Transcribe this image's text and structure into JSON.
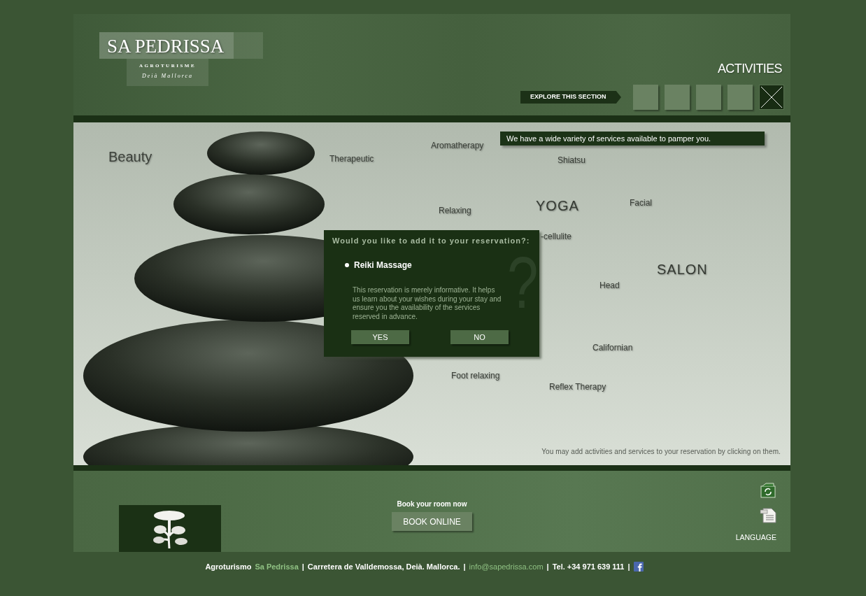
{
  "header": {
    "logo": {
      "name": "SA PEDRISSA",
      "subtitle": "AGROTURISME",
      "location": "Deià Mallorca"
    },
    "title": "ACTIVITIES",
    "explore": "EXPLORE THIS SECTION",
    "tiles": [
      {
        "kind": "blank"
      },
      {
        "kind": "blank"
      },
      {
        "kind": "blank"
      },
      {
        "kind": "blank"
      },
      {
        "kind": "close"
      }
    ]
  },
  "content": {
    "heading": "Beauty",
    "banner": "We have a wide variety of services available to pamper you.",
    "words": [
      {
        "text": "Therapeutic",
        "kind": "service"
      },
      {
        "text": "Aromatherapy",
        "kind": "service"
      },
      {
        "text": "Shiatsu",
        "kind": "service"
      },
      {
        "text": "Relaxing",
        "kind": "service"
      },
      {
        "text": "YOGA",
        "kind": "category"
      },
      {
        "text": "Facial",
        "kind": "service"
      },
      {
        "text": "-cellulite",
        "kind": "service"
      },
      {
        "text": "SALON",
        "kind": "category"
      },
      {
        "text": "Head",
        "kind": "service"
      },
      {
        "text": "Californian",
        "kind": "service"
      },
      {
        "text": "Foot relaxing",
        "kind": "service"
      },
      {
        "text": "Reflex Therapy",
        "kind": "service"
      }
    ],
    "note": "You may add activities and services to your reservation by clicking on them."
  },
  "dialog": {
    "question": "Would you like to add it to your reservation?:",
    "item": "Reiki Massage",
    "info": "This reservation is merely informative. It helps us learn about your wishes during your stay and ensure you the availability of the services reserved in advance.",
    "question_mark": "?",
    "buttons": [
      "YES",
      "NO"
    ]
  },
  "footer": {
    "book_label": "Book your room now",
    "book_button": "BOOK ONLINE",
    "language": "LANGUAGE",
    "contact": [
      {
        "kind": "text",
        "text": "Agroturismo"
      },
      {
        "kind": "brand",
        "text": "Sa Pedrissa"
      },
      {
        "kind": "separator",
        "text": "|"
      },
      {
        "kind": "text",
        "text": "Carretera de Valldemossa, Deià. Mallorca."
      },
      {
        "kind": "separator",
        "text": "|"
      },
      {
        "kind": "link",
        "text": "info@sapedrissa.com"
      },
      {
        "kind": "separator",
        "text": "|"
      },
      {
        "kind": "text",
        "text": "Tel. +34 971 639 111"
      },
      {
        "kind": "separator",
        "text": "|"
      },
      {
        "kind": "social"
      }
    ]
  }
}
